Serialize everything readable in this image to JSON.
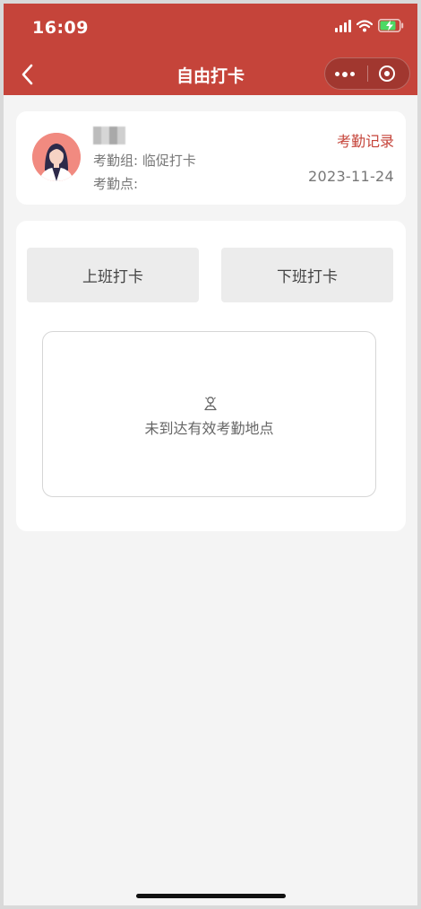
{
  "status_bar": {
    "time": "16:09",
    "icons": [
      "signal-icon",
      "wifi-icon",
      "battery-charging-icon"
    ]
  },
  "nav": {
    "title": "自由打卡",
    "back_icon": "chevron-left-icon",
    "capsule_icons": [
      "more-icon",
      "close-target-icon"
    ]
  },
  "profile": {
    "name": "",
    "group_label": "考勤组: 临促打卡",
    "point_label": "考勤点:",
    "records_link": "考勤记录",
    "date": "2023-11-24"
  },
  "punch": {
    "clock_in_label": "上班打卡",
    "clock_out_label": "下班打卡"
  },
  "location": {
    "status_text": "未到达有效考勤地点",
    "icon": "location-marker-icon"
  },
  "colors": {
    "brand": "#c5443a",
    "background": "#f4f4f4",
    "button_bg": "#ececec",
    "avatar_bg": "#f18a80"
  }
}
